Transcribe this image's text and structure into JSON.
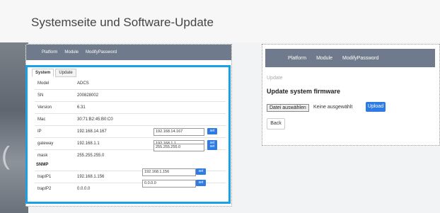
{
  "page_title": "Systemseite und Software-Update",
  "left_panel": {
    "nav": [
      "Platform",
      "Module",
      "ModifyPassword"
    ],
    "tabs": [
      "System",
      "Update"
    ],
    "rows": [
      {
        "label": "Model",
        "value": "ADCS"
      },
      {
        "label": "SN",
        "value": "200828002"
      },
      {
        "label": "Version",
        "value": "6.31"
      },
      {
        "label": "Mac",
        "value": "30:71:B2:45:B0:C0"
      },
      {
        "label": "IP",
        "value": "192.168.14.167",
        "input": "192.168.14.167",
        "btn": "set"
      },
      {
        "label": "gateway",
        "value": "192.168.1.1",
        "input": "192.168.1.1",
        "btn": "set"
      },
      {
        "label": "mask",
        "value": "255.255.255.0",
        "input": "255.255.255.0",
        "btn": "set"
      }
    ],
    "snmp_title": "SNMP",
    "snmp_rows": [
      {
        "label": "trapIP1",
        "value": "192.168.1.156",
        "input": "192.168.1.156",
        "btn": "set"
      },
      {
        "label": "trapIP2",
        "value": "0.0.0.0",
        "input": "0.0.0.0",
        "btn": "set"
      }
    ]
  },
  "right_panel": {
    "nav": [
      "Platform",
      "Module",
      "ModifyPassword"
    ],
    "breadcrumb": "Update",
    "heading": "Update system firmware",
    "file_button": "Datei auswählen",
    "file_status": "Keine ausgewählt",
    "upload_label": "Upload",
    "back_label": "Back"
  },
  "colors": {
    "accent_blue": "#1aa0e6",
    "button_blue": "#2e7be3",
    "navbar": "#6f7b8c"
  }
}
